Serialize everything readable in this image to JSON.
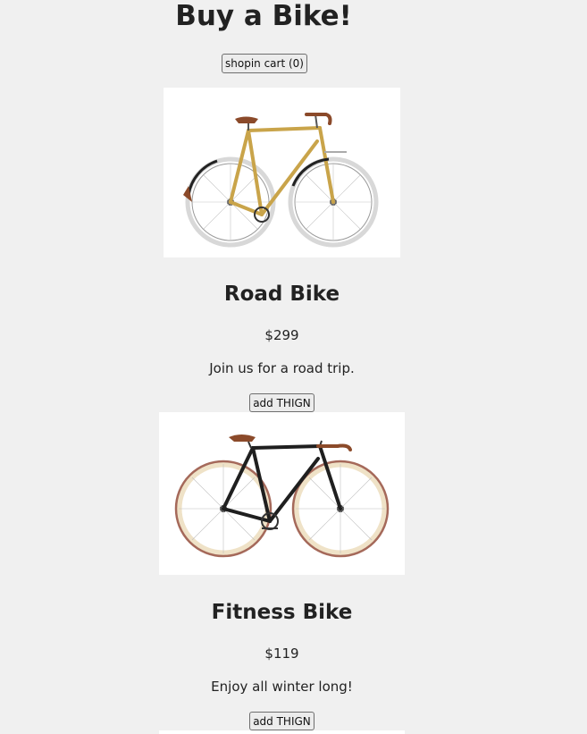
{
  "page": {
    "title": "Buy a Bike!",
    "cart_button_label": "shopin cart (0)"
  },
  "products": [
    {
      "name": "Road Bike",
      "price": "$299",
      "description": "Join us for a road trip.",
      "add_button_label": "add THIGN",
      "image_icon": "bike-photo-icon",
      "frame_color": "#c9a44a",
      "tire_color": "#e8e8e8"
    },
    {
      "name": "Fitness Bike",
      "price": "$119",
      "description": "Enjoy all winter long!",
      "add_button_label": "add THIGN",
      "image_icon": "bike-photo-icon",
      "frame_color": "#1f1f1f",
      "tire_color": "#b58a78"
    }
  ]
}
